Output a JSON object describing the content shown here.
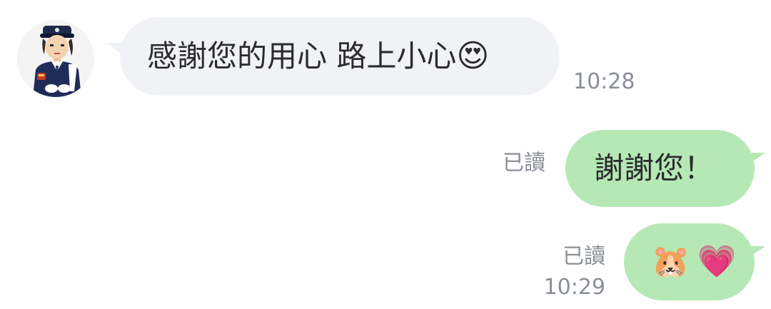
{
  "messages": [
    {
      "direction": "incoming",
      "text": "感謝您的用心 路上小心",
      "emoji": "😍",
      "time": "10:28"
    },
    {
      "direction": "outgoing",
      "text": "謝謝您！",
      "read_status": "已讀"
    },
    {
      "direction": "outgoing",
      "emojis": [
        "🐹",
        "💗"
      ],
      "read_status": "已讀",
      "time": "10:29"
    }
  ],
  "avatar": {
    "icon": "police-officer-avatar-icon"
  },
  "colors": {
    "incoming_bubble": "#f1f2f5",
    "outgoing_bubble": "#b6e8b6",
    "meta_text": "#8a8f96"
  }
}
